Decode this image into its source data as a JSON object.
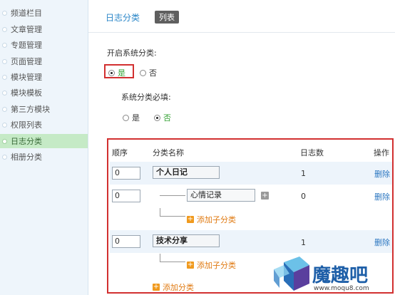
{
  "sidebar": {
    "items": [
      {
        "label": "频道栏目"
      },
      {
        "label": "文章管理"
      },
      {
        "label": "专题管理"
      },
      {
        "label": "页面管理"
      },
      {
        "label": "模块管理"
      },
      {
        "label": "模块模板"
      },
      {
        "label": "第三方模块"
      },
      {
        "label": "权限列表"
      },
      {
        "label": "日志分类"
      },
      {
        "label": "相册分类"
      }
    ],
    "active_label": "日志分类"
  },
  "header": {
    "title": "日志分类",
    "tab": "列表"
  },
  "settings": {
    "enable_label": "开启系统分类:",
    "enable_yes": "是",
    "enable_no": "否",
    "enable_value": "是",
    "required_label": "系统分类必填:",
    "required_yes": "是",
    "required_no": "否",
    "required_value": "否"
  },
  "table": {
    "headers": {
      "order": "顺序",
      "name": "分类名称",
      "count": "日志数",
      "action": "操作"
    },
    "rows": [
      {
        "order": "0",
        "name": "个人日记",
        "count": "1",
        "action": "删除"
      },
      {
        "order": "0",
        "name": "心情记录",
        "count": "0",
        "action": "删除"
      },
      {
        "order": "0",
        "name": "技术分享",
        "count": "1",
        "action": "删除"
      }
    ],
    "add_child_label": "添加子分类",
    "add_label": "添加分类"
  },
  "watermark": {
    "brand": "魔趣吧",
    "url": "www.moqu8.com"
  },
  "colors": {
    "accent": "#2a86c8",
    "highlight": "#d23030",
    "active_bg": "#c5eac6",
    "add": "#e07a12"
  }
}
